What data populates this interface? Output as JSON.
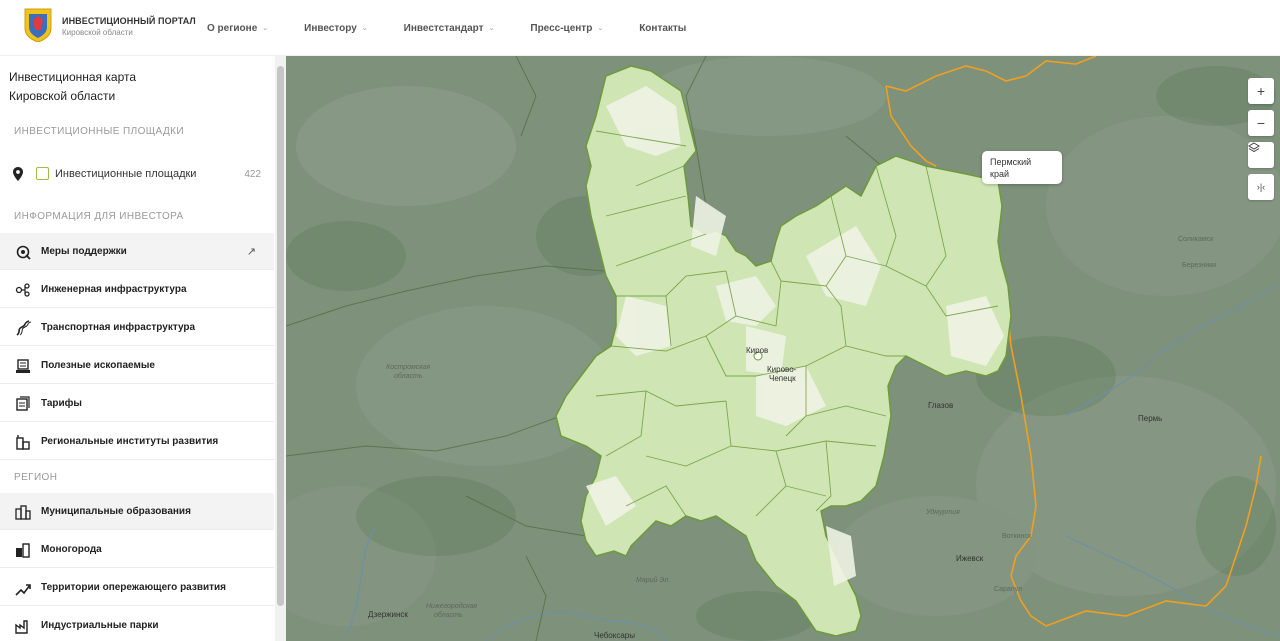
{
  "header": {
    "logo_title": "ИНВЕСТИЦИОННЫЙ ПОРТАЛ",
    "logo_subtitle": "Кировской области",
    "nav": [
      {
        "label": "О регионе",
        "has_dropdown": true
      },
      {
        "label": "Инвестору",
        "has_dropdown": true
      },
      {
        "label": "Инвестстандарт",
        "has_dropdown": true
      },
      {
        "label": "Пресс-центр",
        "has_dropdown": true
      },
      {
        "label": "Контакты",
        "has_dropdown": false
      }
    ]
  },
  "sidebar": {
    "title_line1": "Инвестиционная карта",
    "title_line2": "Кировской области",
    "section_sites": "ИНВЕСТИЦИОННЫЕ ПЛОЩАДКИ",
    "sites_filter": {
      "label": "Инвестиционные площадки",
      "count": "422",
      "checked": false,
      "icon": "map-pin-icon"
    },
    "section_investor": "ИНФОРМАЦИЯ ДЛЯ ИНВЕСТОРА",
    "investor_items": [
      {
        "label": "Меры поддержки",
        "icon": "support-icon",
        "external": "↗"
      },
      {
        "label": "Инженерная инфраструктура",
        "icon": "engineering-icon"
      },
      {
        "label": "Транспортная инфраструктура",
        "icon": "road-icon"
      },
      {
        "label": "Полезные ископаемые",
        "icon": "minerals-icon"
      },
      {
        "label": "Тарифы",
        "icon": "tariffs-icon"
      },
      {
        "label": "Региональные институты развития",
        "icon": "institutions-icon"
      }
    ],
    "section_region": "РЕГИОН",
    "region_items": [
      {
        "label": "Муниципальные образования",
        "icon": "municipality-icon"
      },
      {
        "label": "Моногорода",
        "icon": "monotown-icon"
      },
      {
        "label": "Территории опережающего развития",
        "icon": "development-zone-icon"
      },
      {
        "label": "Индустриальные парки",
        "icon": "industrial-park-icon"
      }
    ]
  },
  "map": {
    "controls": [
      {
        "name": "zoom-in",
        "glyph": "+"
      },
      {
        "name": "zoom-out",
        "glyph": "−"
      },
      {
        "name": "layers",
        "glyph": ""
      },
      {
        "name": "split",
        "glyph": "›|‹"
      }
    ],
    "tooltip_line1": "Пермский",
    "tooltip_line2": "край",
    "labels": {
      "kirov": "Киров",
      "kirovo_chepetsk1": "Кирово-",
      "kirovo_chepetsk2": "Чепецк",
      "glazov": "Глазов",
      "perm": "Пермь",
      "izhevsk": "Ижевск",
      "votkinsk": "Воткинск",
      "sarapul": "Сарапул",
      "solikamsk": "Соликамск",
      "berezniki": "Березники",
      "kostroma1": "Костромская",
      "kostroma2": "область",
      "mari_el": "Марий Эл",
      "nizhny1": "Нижегородская",
      "nizhny2": "область",
      "dzerzhinsk": "Дзержинск",
      "cheboksary": "Чебоксары",
      "udmurtia": "Удмуртия"
    },
    "colors": {
      "region_fill": "#cfe6b4",
      "region_border": "#6f9a3b",
      "outside": "#7a8f78",
      "perm_border": "#f0a020"
    }
  }
}
